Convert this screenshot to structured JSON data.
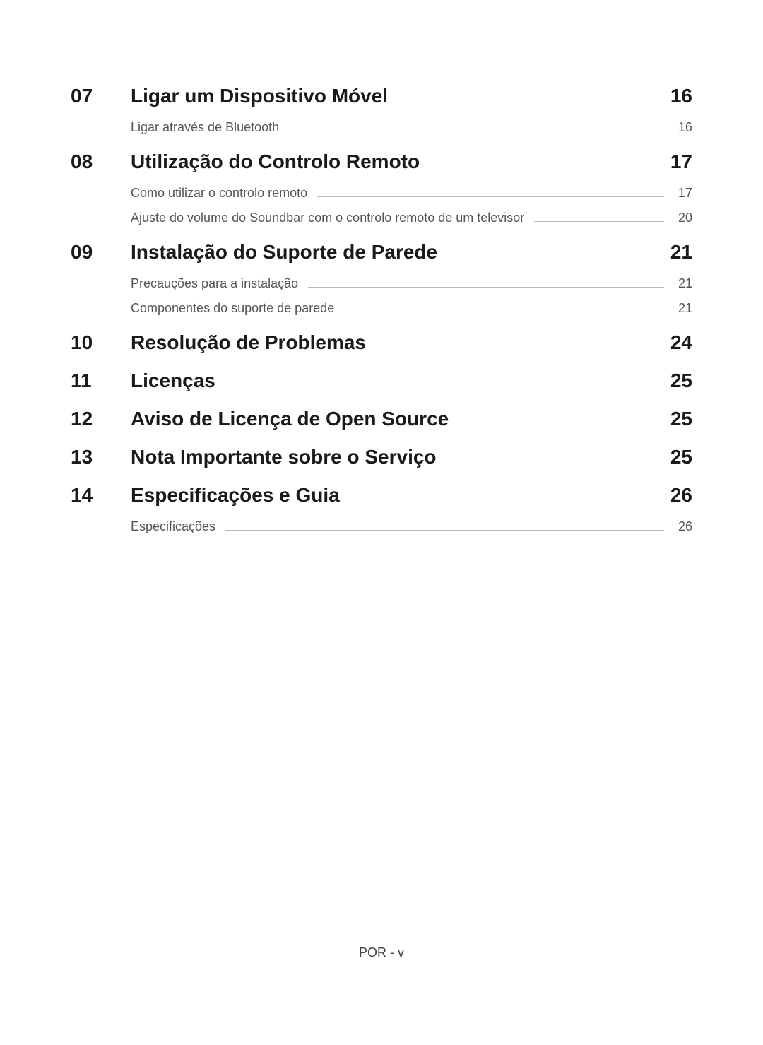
{
  "sections": [
    {
      "number": "07",
      "title": "Ligar um Dispositivo Móvel",
      "page": "16",
      "subs": [
        {
          "title": "Ligar através de Bluetooth",
          "page": "16"
        }
      ]
    },
    {
      "number": "08",
      "title": "Utilização do Controlo Remoto",
      "page": "17",
      "subs": [
        {
          "title": "Como utilizar o controlo remoto",
          "page": "17"
        },
        {
          "title": "Ajuste do volume do Soundbar com o controlo remoto de um televisor",
          "page": "20"
        }
      ]
    },
    {
      "number": "09",
      "title": "Instalação do Suporte de Parede",
      "page": "21",
      "subs": [
        {
          "title": "Precauções para a instalação",
          "page": "21"
        },
        {
          "title": "Componentes do suporte de parede",
          "page": "21"
        }
      ]
    },
    {
      "number": "10",
      "title": "Resolução de Problemas",
      "page": "24",
      "subs": []
    },
    {
      "number": "11",
      "title": "Licenças",
      "page": "25",
      "subs": []
    },
    {
      "number": "12",
      "title": "Aviso de Licença de Open Source",
      "page": "25",
      "subs": []
    },
    {
      "number": "13",
      "title": "Nota Importante sobre o Serviço",
      "page": "25",
      "subs": []
    },
    {
      "number": "14",
      "title": "Especificações e Guia",
      "page": "26",
      "subs": [
        {
          "title": "Especificações",
          "page": "26"
        }
      ]
    }
  ],
  "footer": "POR - v"
}
